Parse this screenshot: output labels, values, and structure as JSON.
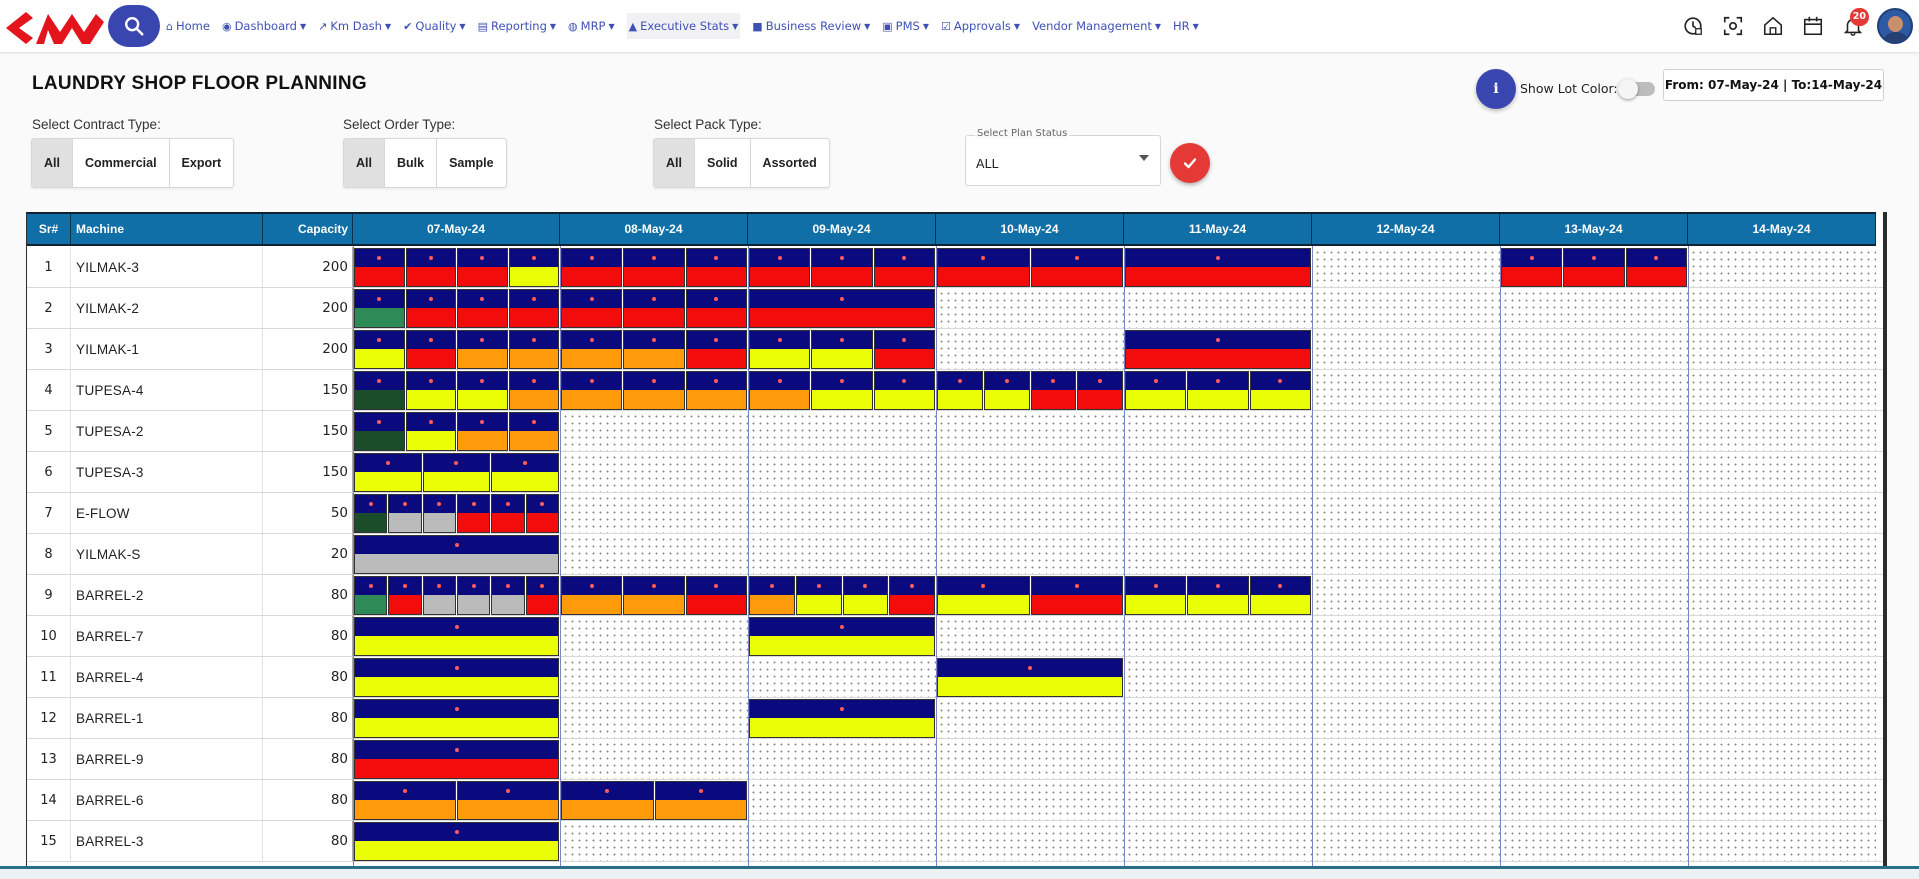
{
  "nav": {
    "items": [
      {
        "label": "Home",
        "icon": "home-icon",
        "dropdown": false
      },
      {
        "label": "Dashboard",
        "icon": "dashboard-icon",
        "dropdown": true
      },
      {
        "label": "Km Dash",
        "icon": "chart-line-icon",
        "dropdown": true
      },
      {
        "label": "Quality",
        "icon": "check-circle-icon",
        "dropdown": true
      },
      {
        "label": "Reporting",
        "icon": "file-icon",
        "dropdown": true
      },
      {
        "label": "MRP",
        "icon": "globe-icon",
        "dropdown": true
      },
      {
        "label": "Executive Stats",
        "icon": "area-chart-icon",
        "dropdown": true
      },
      {
        "label": "Business Review",
        "icon": "briefcase-icon",
        "dropdown": true
      },
      {
        "label": "PMS",
        "icon": "id-card-icon",
        "dropdown": true
      },
      {
        "label": "Approvals",
        "icon": "check-square-icon",
        "dropdown": true
      },
      {
        "label": "Vendor Management",
        "icon": "",
        "dropdown": true
      },
      {
        "label": "HR",
        "icon": "",
        "dropdown": true
      }
    ],
    "notification_count": "20"
  },
  "page": {
    "title": "LAUNDRY SHOP FLOOR PLANNING",
    "show_lot_color_label": "Show Lot Color:",
    "date_range": "From: 07-May-24 | To:14-May-24"
  },
  "filters": {
    "contract": {
      "label": "Select Contract Type:",
      "options": [
        "All",
        "Commercial",
        "Export"
      ],
      "selected": "All"
    },
    "order": {
      "label": "Select Order Type:",
      "options": [
        "All",
        "Bulk",
        "Sample"
      ],
      "selected": "All"
    },
    "pack": {
      "label": "Select Pack Type:",
      "options": [
        "All",
        "Solid",
        "Assorted"
      ],
      "selected": "All"
    },
    "plan_status": {
      "label": "Select Plan Status",
      "value": "ALL"
    }
  },
  "grid": {
    "headers": {
      "sr": "Sr#",
      "machine": "Machine",
      "capacity": "Capacity"
    },
    "days": [
      "07-May-24",
      "08-May-24",
      "09-May-24",
      "10-May-24",
      "11-May-24",
      "12-May-24",
      "13-May-24",
      "14-May-24"
    ],
    "rows": [
      {
        "sr": "1",
        "machine": "YILMAK-3",
        "capacity": "200",
        "lots": [
          [
            "red",
            "red",
            "red",
            "yellow"
          ],
          [
            "red",
            "red",
            "red"
          ],
          [
            "red",
            "red",
            "red"
          ],
          [
            "red",
            "red"
          ],
          [
            "red"
          ],
          [],
          [
            "red",
            "red",
            "red"
          ],
          []
        ]
      },
      {
        "sr": "2",
        "machine": "YILMAK-2",
        "capacity": "200",
        "lots": [
          [
            "green",
            "red",
            "red",
            "red"
          ],
          [
            "red",
            "red",
            "red"
          ],
          [
            "red"
          ],
          [],
          [],
          [],
          [],
          []
        ]
      },
      {
        "sr": "3",
        "machine": "YILMAK-1",
        "capacity": "200",
        "lots": [
          [
            "yellow",
            "red",
            "orange",
            "orange"
          ],
          [
            "orange",
            "orange",
            "red"
          ],
          [
            "yellow",
            "yellow",
            "red"
          ],
          [],
          [
            "red"
          ],
          [],
          [],
          []
        ]
      },
      {
        "sr": "4",
        "machine": "TUPESA-4",
        "capacity": "150",
        "lots": [
          [
            "dkgreen",
            "yellow",
            "yellow",
            "orange"
          ],
          [
            "orange",
            "orange",
            "orange"
          ],
          [
            "orange",
            "yellow",
            "yellow"
          ],
          [
            "yellow",
            "yellow",
            "red",
            "red"
          ],
          [
            "yellow",
            "yellow",
            "yellow"
          ],
          [],
          [],
          []
        ]
      },
      {
        "sr": "5",
        "machine": "TUPESA-2",
        "capacity": "150",
        "lots": [
          [
            "dkgreen",
            "yellow",
            "orange",
            "orange"
          ],
          [],
          [],
          [],
          [],
          [],
          [],
          []
        ]
      },
      {
        "sr": "6",
        "machine": "TUPESA-3",
        "capacity": "150",
        "lots": [
          [
            "yellow",
            "yellow",
            "yellow"
          ],
          [],
          [],
          [],
          [],
          [],
          [],
          []
        ]
      },
      {
        "sr": "7",
        "machine": "E-FLOW",
        "capacity": "50",
        "lots": [
          [
            "dkgreen",
            "gray",
            "gray",
            "red",
            "red",
            "red"
          ],
          [],
          [],
          [],
          [],
          [],
          [],
          []
        ]
      },
      {
        "sr": "8",
        "machine": "YILMAK-S",
        "capacity": "20",
        "lots": [
          [
            "gray"
          ],
          [],
          [],
          [],
          [],
          [],
          [],
          []
        ]
      },
      {
        "sr": "9",
        "machine": "BARREL-2",
        "capacity": "80",
        "lots": [
          [
            "green",
            "red",
            "gray",
            "gray",
            "gray",
            "red"
          ],
          [
            "orange",
            "orange",
            "red"
          ],
          [
            "orange",
            "yellow",
            "yellow",
            "red"
          ],
          [
            "yellow",
            "red"
          ],
          [
            "yellow",
            "yellow",
            "yellow"
          ],
          [],
          [],
          []
        ]
      },
      {
        "sr": "10",
        "machine": "BARREL-7",
        "capacity": "80",
        "lots": [
          [
            "yellow"
          ],
          [],
          [
            "yellow"
          ],
          [],
          [],
          [],
          [],
          []
        ]
      },
      {
        "sr": "11",
        "machine": "BARREL-4",
        "capacity": "80",
        "lots": [
          [
            "yellow"
          ],
          [],
          [],
          [
            "yellow"
          ],
          [],
          [],
          [],
          []
        ]
      },
      {
        "sr": "12",
        "machine": "BARREL-1",
        "capacity": "80",
        "lots": [
          [
            "yellow"
          ],
          [],
          [
            "yellow"
          ],
          [],
          [],
          [],
          [],
          []
        ]
      },
      {
        "sr": "13",
        "machine": "BARREL-9",
        "capacity": "80",
        "lots": [
          [
            "red"
          ],
          [],
          [],
          [],
          [],
          [],
          [],
          []
        ]
      },
      {
        "sr": "14",
        "machine": "BARREL-6",
        "capacity": "80",
        "lots": [
          [
            "orange",
            "orange"
          ],
          [
            "orange",
            "orange"
          ],
          [],
          [],
          [],
          [],
          [],
          []
        ]
      },
      {
        "sr": "15",
        "machine": "BARREL-3",
        "capacity": "80",
        "lots": [
          [
            "yellow"
          ],
          [],
          [],
          [],
          [],
          [],
          [],
          []
        ]
      }
    ]
  },
  "colors": {
    "lot_top": "#0a0a7e",
    "header_bg": "#0f6fa6",
    "accent": "#3a46b0",
    "apply": "#e53935"
  }
}
